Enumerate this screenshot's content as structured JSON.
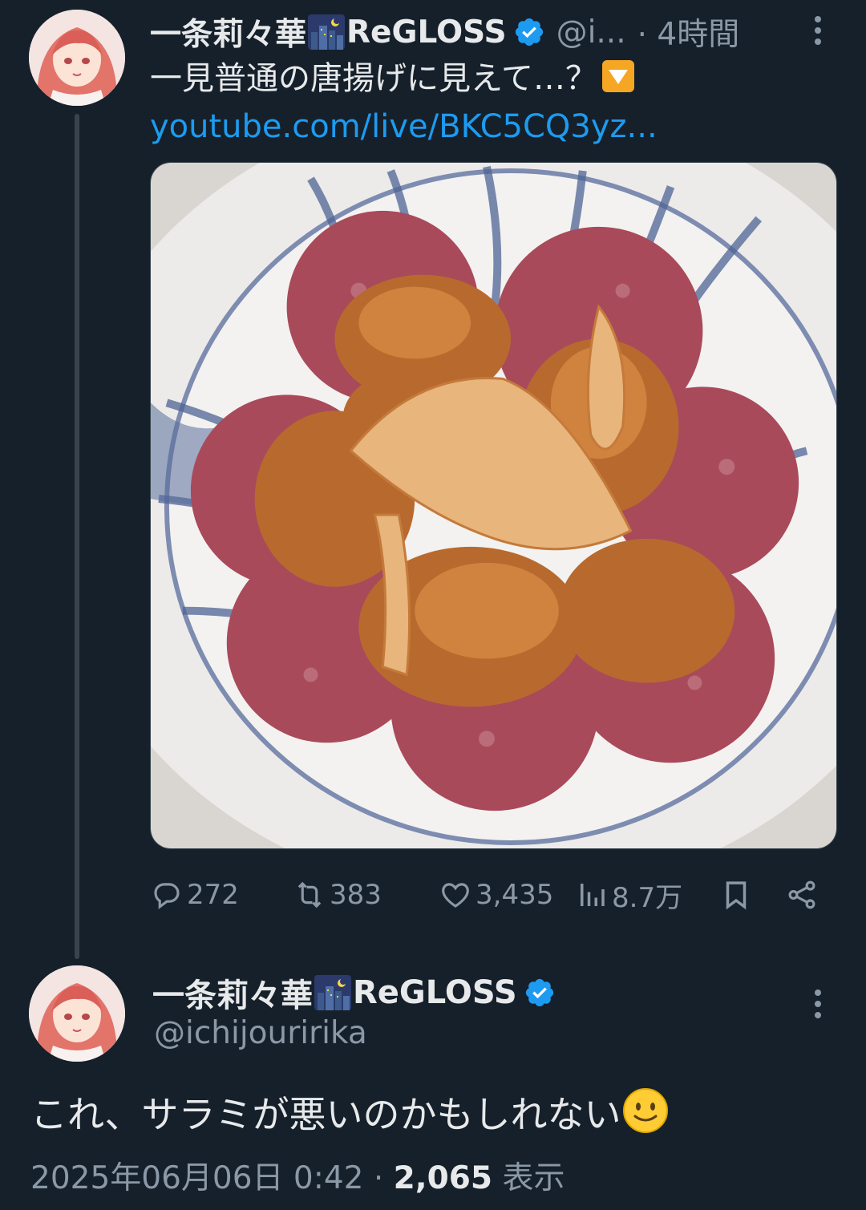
{
  "tweet1": {
    "display_name": "一条莉々華",
    "name_suffix": "ReGLOSS",
    "handle": "@i...",
    "time": "· 4時間",
    "text": "一見普通の唐揚げに見えて…？",
    "link": "youtube.com/live/BKC5CQ3yz...",
    "media_alt": "karaage with salami",
    "actions": {
      "replies": "272",
      "reposts": "383",
      "likes": "3,435",
      "views": "8.7万"
    }
  },
  "tweet2": {
    "display_name": "一条莉々華",
    "name_suffix": "ReGLOSS",
    "handle": "@ichijouririka",
    "text": "これ、サラミが悪いのかもしれない",
    "timestamp": "2025年06月06日 0:42 · ",
    "view_count": "2,065",
    "view_label": " 表示"
  },
  "colors": {
    "background": "#15202b",
    "text": "#e7e9ea",
    "muted": "#8b98a5",
    "link": "#1d9bf0",
    "verified": "#1d9bf0"
  },
  "icons": [
    "verified-badge-icon",
    "more-icon",
    "reply-icon",
    "repost-icon",
    "like-icon",
    "views-icon",
    "bookmark-icon",
    "share-icon",
    "down-arrow-emoji",
    "smile-emoji",
    "night-city-emoji"
  ]
}
